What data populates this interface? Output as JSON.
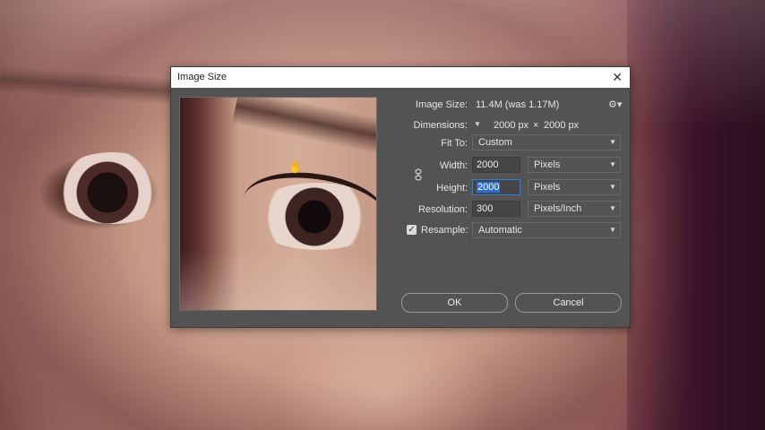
{
  "dialog": {
    "title": "Image Size",
    "image_size_label": "Image Size:",
    "image_size_value": "11.4M (was 1.17M)",
    "dimensions_label": "Dimensions:",
    "dimensions_width": "2000 px",
    "dimensions_sep": "×",
    "dimensions_height": "2000 px",
    "fit_to_label": "Fit To:",
    "fit_to_value": "Custom",
    "width_label": "Width:",
    "width_value": "2000",
    "width_unit": "Pixels",
    "height_label": "Height:",
    "height_value": "2000",
    "height_unit": "Pixels",
    "resolution_label": "Resolution:",
    "resolution_value": "300",
    "resolution_unit": "Pixels/Inch",
    "resample_label": "Resample:",
    "resample_checked": true,
    "resample_value": "Automatic",
    "ok_label": "OK",
    "cancel_label": "Cancel"
  },
  "icons": {
    "close": "close-icon",
    "gear": "gear-icon",
    "hand": "hand-icon",
    "link": "link-icon"
  },
  "colors": {
    "dialog_bg": "#535353",
    "field_bg": "#454545",
    "selection": "#2f6fd0"
  }
}
